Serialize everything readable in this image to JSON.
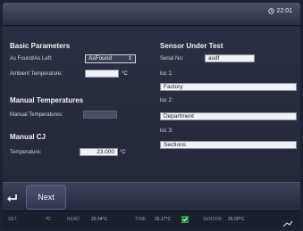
{
  "header": {
    "time": "22:01"
  },
  "basic": {
    "title": "Basic Parameters",
    "as_found_label": "As Found/As Left:",
    "as_found_value": "AsFound",
    "ambient_label": "Ambient Temperature:",
    "ambient_value": "",
    "ambient_unit": "°C"
  },
  "manual_temp": {
    "title": "Manual Temperatures",
    "label": "Manual Temperatures:"
  },
  "manual_cj": {
    "title": "Manual CJ",
    "temp_label": "Temperature:",
    "temp_value": "23.000",
    "temp_unit": "°C"
  },
  "sensor": {
    "title": "Sensor Under Test",
    "serial_label": "Serial No:",
    "serial_value": "asdf",
    "loc1_label": "loc 1:",
    "loc1_value": "Factory",
    "loc2_label": "loc 2:",
    "loc2_value": "Department",
    "loc3_label": "loc 3:",
    "loc3_value": "Sections"
  },
  "footer": {
    "next_label": "Next"
  },
  "status": {
    "s1": "SET",
    "s1_val": "°C",
    "s2": "READ",
    "s2_val": "25.54°C",
    "s3": "TIME",
    "s3_val": "25.17°C",
    "s4": "SENSOR",
    "s4_val": "25.00°C"
  }
}
